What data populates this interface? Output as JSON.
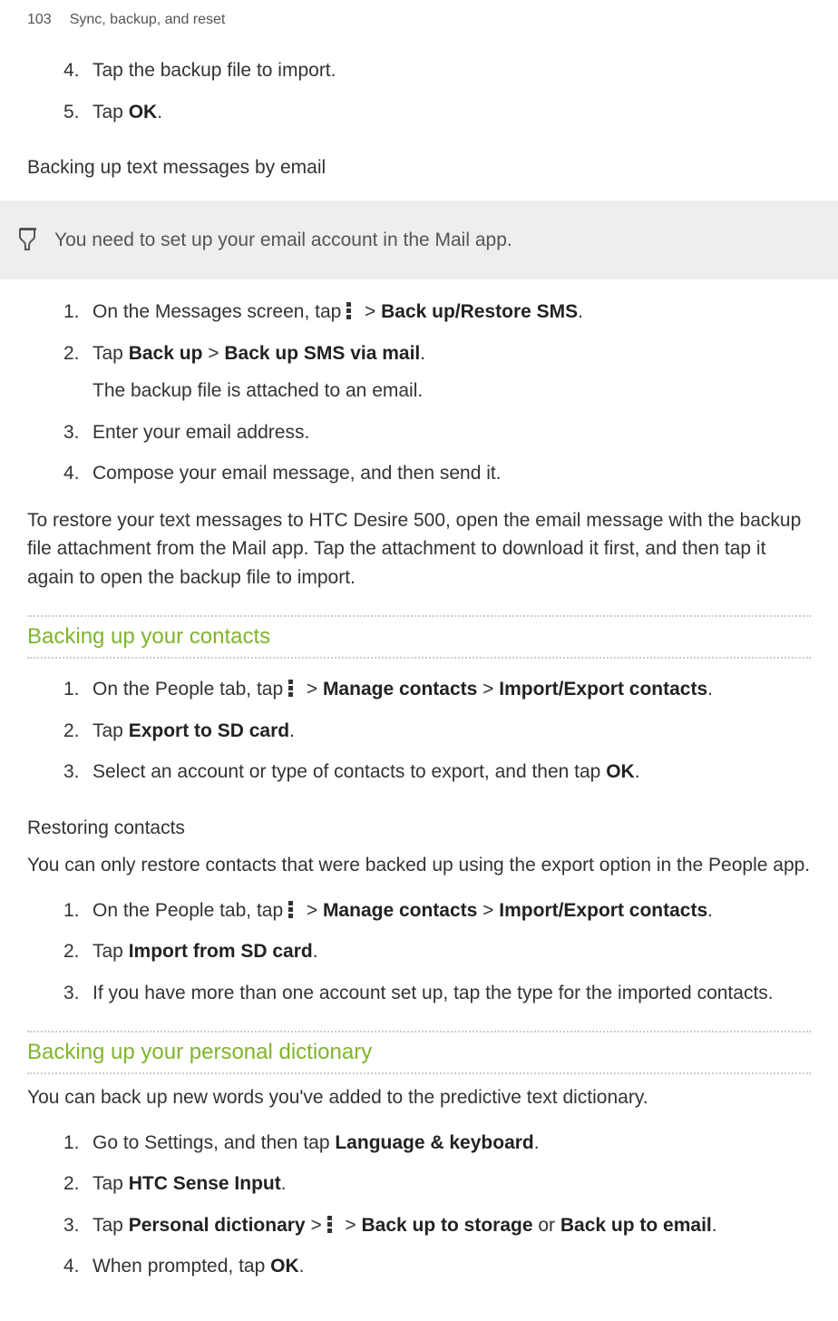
{
  "header": {
    "page_number": "103",
    "chapter": "Sync, backup, and reset"
  },
  "intro_steps": [
    {
      "num": "4.",
      "text_a": "Tap the backup file to import."
    },
    {
      "num": "5.",
      "text_a": "Tap ",
      "bold_a": "OK",
      "text_b": "."
    }
  ],
  "subheading1": "Backing up text messages by email",
  "note1": "You need to set up your email account in the Mail app.",
  "steps2": {
    "s1": {
      "num": "1.",
      "a": "On the Messages screen, tap ",
      "b": " > ",
      "bold1": "Back up/Restore SMS",
      "c": "."
    },
    "s2": {
      "num": "2.",
      "a": "Tap ",
      "bold1": "Back up",
      "b": " > ",
      "bold2": "Back up SMS via mail",
      "c": ".",
      "line2": "The backup file is attached to an email."
    },
    "s3": {
      "num": "3.",
      "a": "Enter your email address."
    },
    "s4": {
      "num": "4.",
      "a": "Compose your email message, and then send it."
    }
  },
  "para_after2": "To restore your text messages to HTC Desire 500, open the email message with the backup file attachment from the Mail app. Tap the attachment to download it first, and then tap it again to open the backup file to import.",
  "section2_title": "Backing up your contacts",
  "steps3": {
    "s1": {
      "num": "1.",
      "a": "On the People tab, tap ",
      "b": " > ",
      "bold1": "Manage contacts",
      "c": " > ",
      "bold2": "Import/Export contacts",
      "d": "."
    },
    "s2": {
      "num": "2.",
      "a": "Tap ",
      "bold1": "Export to SD card",
      "b": "."
    },
    "s3": {
      "num": "3.",
      "a": "Select an account or type of contacts to export, and then tap ",
      "bold1": "OK",
      "b": "."
    }
  },
  "subheading2": "Restoring contacts",
  "para3": "You can only restore contacts that were backed up using the export option in the People app.",
  "steps4": {
    "s1": {
      "num": "1.",
      "a": "On the People tab, tap ",
      "b": " > ",
      "bold1": "Manage contacts",
      "c": " > ",
      "bold2": "Import/Export contacts",
      "d": "."
    },
    "s2": {
      "num": "2.",
      "a": "Tap ",
      "bold1": "Import from SD card",
      "b": "."
    },
    "s3": {
      "num": "3.",
      "a": "If you have more than one account set up, tap the type for the imported contacts."
    }
  },
  "section3_title": "Backing up your personal dictionary",
  "para4": "You can back up new words you've added to the predictive text dictionary.",
  "steps5": {
    "s1": {
      "num": "1.",
      "a": "Go to Settings, and then tap ",
      "bold1": "Language & keyboard",
      "b": "."
    },
    "s2": {
      "num": "2.",
      "a": "Tap ",
      "bold1": "HTC Sense Input",
      "b": "."
    },
    "s3": {
      "num": "3.",
      "a": "Tap ",
      "bold1": "Personal dictionary",
      "b": " > ",
      "c": " > ",
      "bold2": "Back up to storage",
      "d": " or ",
      "bold3": "Back up to email",
      "e": "."
    },
    "s4": {
      "num": "4.",
      "a": "When prompted, tap ",
      "bold1": "OK",
      "b": "."
    }
  }
}
